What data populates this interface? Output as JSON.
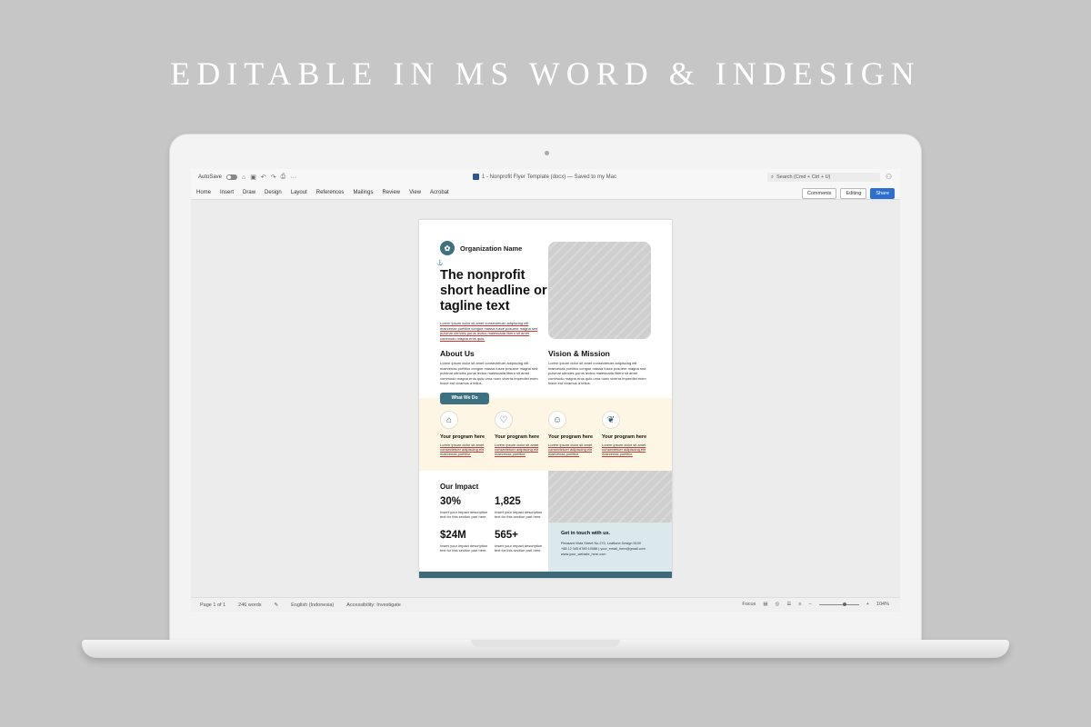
{
  "headline": "EDITABLE IN MS WORD & INDESIGN",
  "titlebar": {
    "autosave": "AutoSave",
    "doc_title": "1 - Nonprofit Flyer Template (docx) — Saved to my Mac",
    "search_placeholder": "Search (Cmd + Ctrl + U)"
  },
  "ribbon": {
    "menu": [
      "Home",
      "Insert",
      "Draw",
      "Design",
      "Layout",
      "References",
      "Mailings",
      "Review",
      "View",
      "Acrobat"
    ],
    "comments": "Comments",
    "editing": "Editing",
    "share": "Share"
  },
  "document": {
    "org_name": "Organization Name",
    "headline": "The nonprofit short headline or tagline text",
    "intro": "Lorem ipsum dolor sit amet consectetuer adipiscing elit maecenas porttitor congue massa fusce posuere magna sed pulvinar ultricies purus lectus malesuada libero sit amet commodo magna eros quis.",
    "about_title": "About Us",
    "about_text": "Lorem ipsum dolor sit amet consectetuer adipiscing elit maecenas porttitor congue massa fusce posuere magna sed pulvinar ultricies purus lectus malesuada libero sit amet commodo magna eros quis urna nunc viverra imperdiet enim fusce est vivamus a tellus.",
    "vision_title": "Vision & Mission",
    "vision_text": "Lorem ipsum dolor sit amet consectetuer adipiscing elit maecenas porttitor congue massa fusce posuere magna sed pulvinar ultricies purus lectus malesuada libero sit amet commodo magna eros quis urna nunc viverra imperdiet enim fusce est vivamus a tellus.",
    "what_we_do": "What We Do",
    "programs": [
      {
        "icon": "home-icon",
        "glyph": "⌂",
        "title": "Your program here",
        "text": "Lorem ipsum dolor sit amet consectetuer adipiscing elit maecenas porttitor."
      },
      {
        "icon": "hand-heart-icon",
        "glyph": "♡",
        "title": "Your program here",
        "text": "Lorem ipsum dolor sit amet consectetuer adipiscing elit maecenas porttitor."
      },
      {
        "icon": "person-icon",
        "glyph": "☺",
        "title": "Your program here",
        "text": "Lorem ipsum dolor sit amet consectetuer adipiscing elit maecenas porttitor."
      },
      {
        "icon": "leaf-icon",
        "glyph": "❦",
        "title": "Your program here",
        "text": "Lorem ipsum dolor sit amet consectetuer adipiscing elit maecenas porttitor."
      }
    ],
    "impact_title": "Our Impact",
    "stats": [
      {
        "value": "30%",
        "text": "Insert your impact description text for this section part here."
      },
      {
        "value": "1,825",
        "text": "Insert your impact description text for this section part here."
      },
      {
        "value": "$24M",
        "text": "Insert your impact description text for this section part here."
      },
      {
        "value": "565+",
        "text": "Insert your impact description text for this section part here."
      }
    ],
    "contact_title": "Get in touch with us.",
    "contact_lines": [
      "Pleasant Vista Street No.270, Leaftone Design 5100",
      "+88 12 345 6789 10088 | your_email_here@gmail.com",
      "www.your_website_here.com"
    ]
  },
  "statusbar": {
    "page": "Page 1 of 1",
    "words": "246 words",
    "language": "English (Indonesia)",
    "accessibility": "Accessibility: Investigate",
    "focus": "Focus",
    "zoom": "104%"
  },
  "colors": {
    "accent": "#3d7180",
    "programs_bg": "#fdf6e4",
    "contact_bg": "#dbe9ec",
    "share": "#2c6fcf"
  }
}
